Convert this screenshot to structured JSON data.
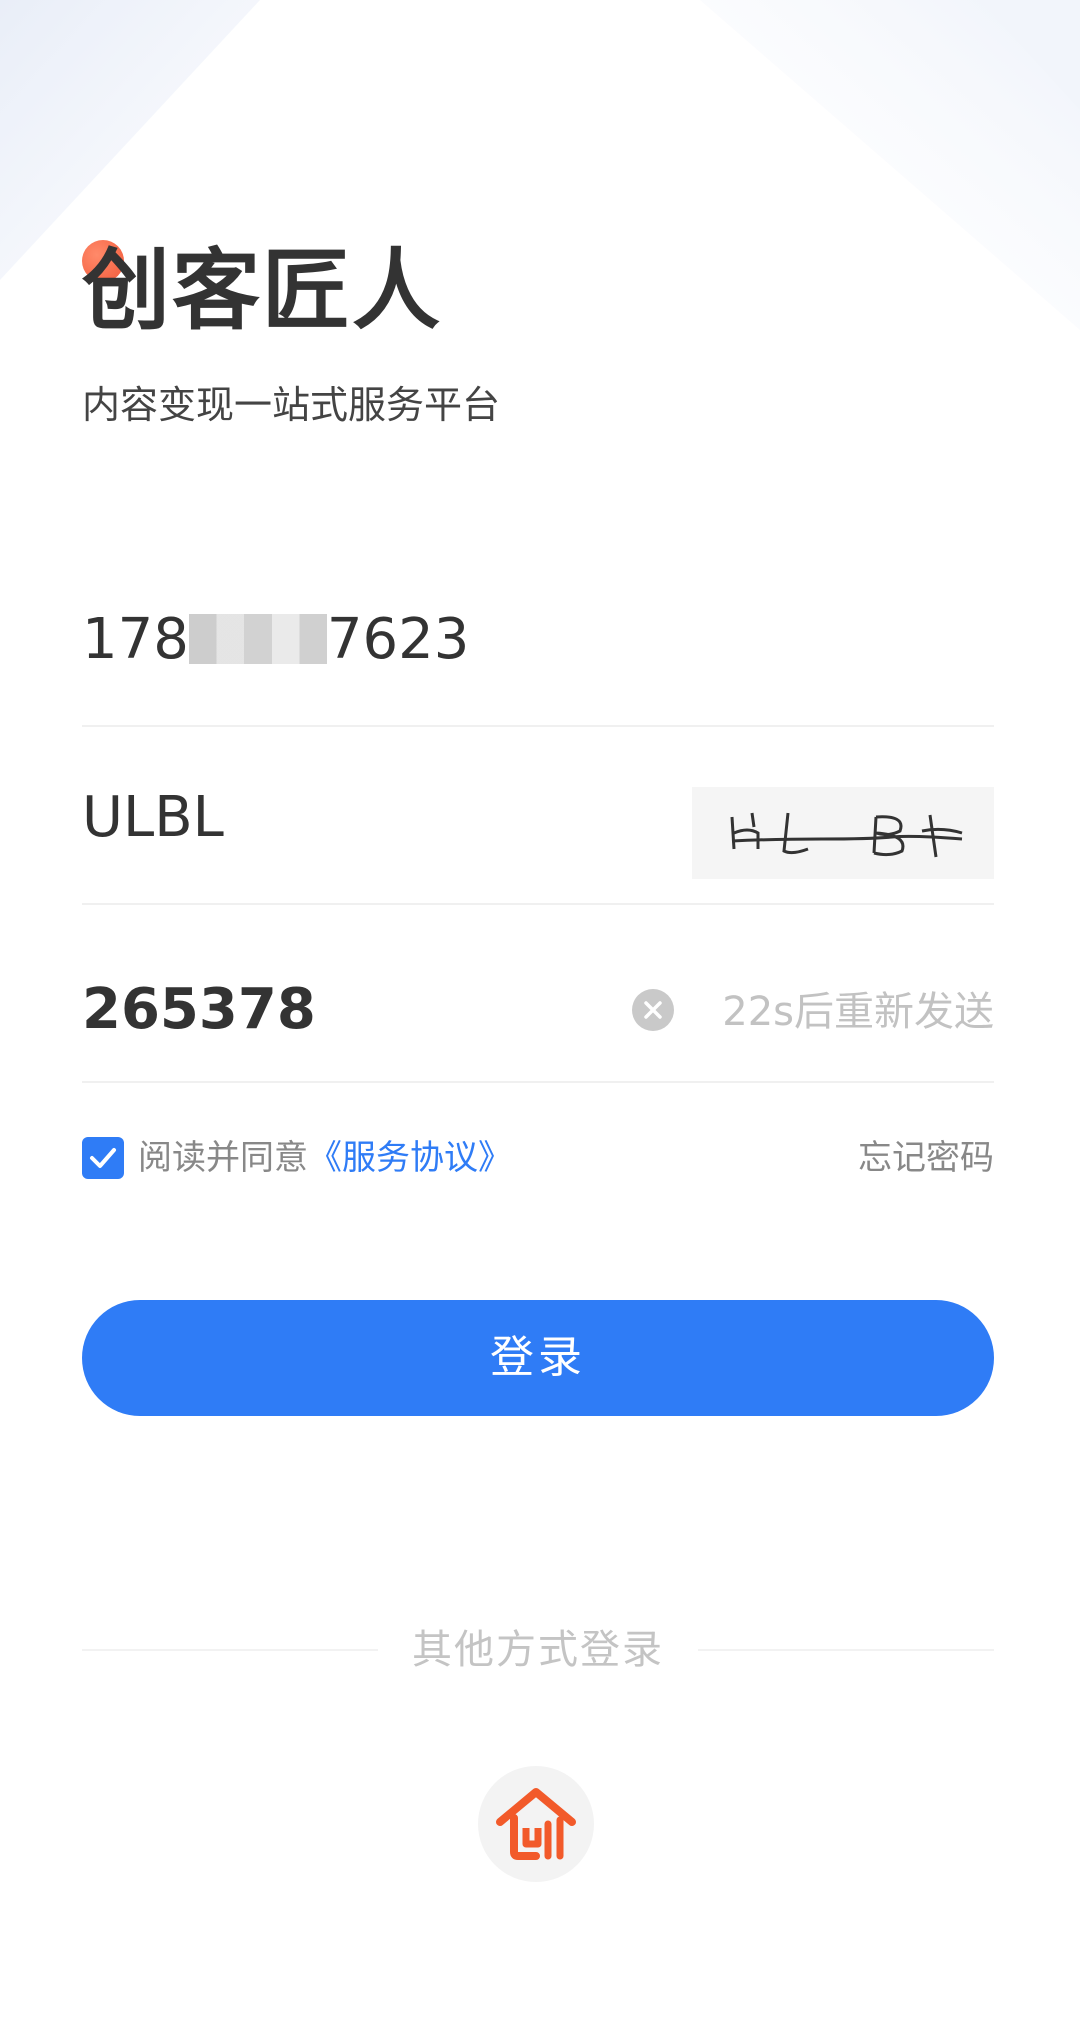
{
  "brand": {
    "title": "创客匠人",
    "subtitle": "内容变现一站式服务平台"
  },
  "form": {
    "phone": {
      "prefix": "178",
      "suffix": "7623"
    },
    "captcha": {
      "value": "ULBL"
    },
    "sms_code": {
      "value": "265378",
      "resend_label": "22s后重新发送"
    }
  },
  "agreement": {
    "prefix": "阅读并同意",
    "link": "《服务协议》",
    "checked": true
  },
  "forgot_password": "忘记密码",
  "login_button": "登录",
  "other_login": {
    "label": "其他方式登录",
    "options": [
      "app-logo-icon"
    ]
  },
  "colors": {
    "primary": "#2f7cf6",
    "accent": "#f25a2a",
    "text": "#333333",
    "muted": "#c2c2c2"
  }
}
